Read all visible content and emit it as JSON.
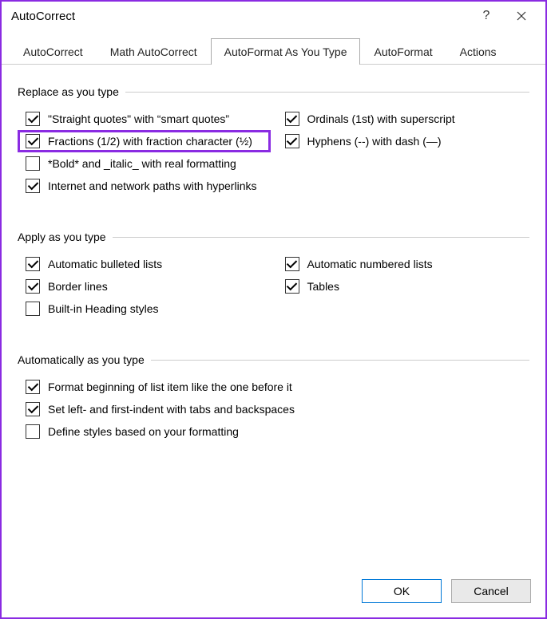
{
  "window": {
    "title": "AutoCorrect",
    "help_label": "?",
    "close_label": "✕"
  },
  "tabs": [
    {
      "label": "AutoCorrect",
      "active": false
    },
    {
      "label": "Math AutoCorrect",
      "active": false
    },
    {
      "label": "AutoFormat As You Type",
      "active": true
    },
    {
      "label": "AutoFormat",
      "active": false
    },
    {
      "label": "Actions",
      "active": false
    }
  ],
  "groups": {
    "replace": {
      "title": "Replace as you type",
      "items": {
        "straight_quotes": {
          "label": "\"Straight quotes\" with “smart quotes”",
          "checked": true
        },
        "ordinals": {
          "label": "Ordinals (1st) with superscript",
          "checked": true
        },
        "fractions": {
          "label": "Fractions (1/2) with fraction character (½)",
          "checked": true,
          "highlighted": true
        },
        "hyphens": {
          "label": "Hyphens (--) with dash (—)",
          "checked": true
        },
        "bold_italic": {
          "label": "*Bold* and _italic_ with real formatting",
          "checked": false
        },
        "hyperlinks": {
          "label": "Internet and network paths with hyperlinks",
          "checked": true
        }
      }
    },
    "apply": {
      "title": "Apply as you type",
      "items": {
        "bulleted": {
          "label": "Automatic bulleted lists",
          "checked": true
        },
        "numbered": {
          "label": "Automatic numbered lists",
          "checked": true
        },
        "borders": {
          "label": "Border lines",
          "checked": true
        },
        "tables": {
          "label": "Tables",
          "checked": true
        },
        "headings": {
          "label": "Built-in Heading styles",
          "checked": false
        }
      }
    },
    "auto": {
      "title": "Automatically as you type",
      "items": {
        "format_begin": {
          "label": "Format beginning of list item like the one before it",
          "checked": true
        },
        "set_indent": {
          "label": "Set left- and first-indent with tabs and backspaces",
          "checked": true
        },
        "define_styles": {
          "label": "Define styles based on your formatting",
          "checked": false
        }
      }
    }
  },
  "buttons": {
    "ok": "OK",
    "cancel": "Cancel"
  }
}
